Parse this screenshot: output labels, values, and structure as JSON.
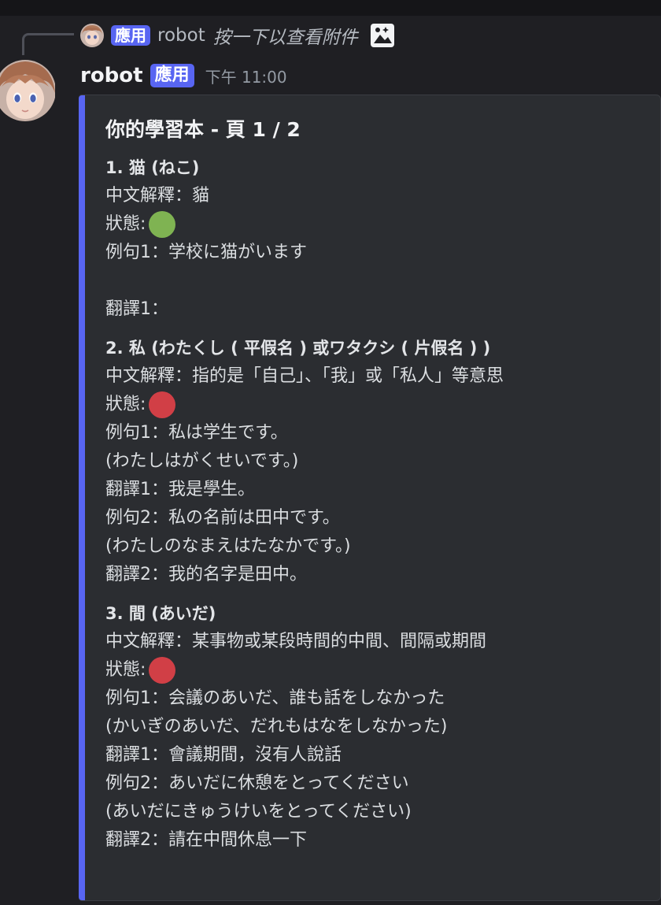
{
  "reply": {
    "badge": "應用",
    "author": "robot",
    "text": "按一下以查看附件",
    "attachment_icon": "image-icon"
  },
  "message": {
    "author": "robot",
    "badge": "應用",
    "timestamp": "下午 11:00"
  },
  "colors": {
    "accent": "#5865f2",
    "status_known": "#7fb352",
    "status_unknown": "#d13f46"
  },
  "embed": {
    "title": "你的學習本 - 頁 1 / 2",
    "entries": [
      {
        "heading": "1. 猫 (ねこ)",
        "meaning": "中文解釋：貓",
        "status_label": "狀態:",
        "status": "known",
        "ex1": "例句1：学校に猫がいます",
        "tr1": "翻譯1："
      },
      {
        "heading": "2. 私 (わたくし ( 平假名 ) 或ワタクシ ( 片假名 ) )",
        "meaning": "中文解釋：指的是「自己」、「我」或「私人」等意思",
        "status_label": "狀態:",
        "status": "unknown",
        "ex1": "例句1：私は学生です。",
        "ex1_reading": "(わたしはがくせいです。)",
        "tr1": "翻譯1：我是學生。",
        "ex2": "例句2：私の名前は田中です。",
        "ex2_reading": "(わたしのなまえはたなかです。)",
        "tr2": "翻譯2：我的名字是田中。"
      },
      {
        "heading": "3. 間 (あいだ)",
        "meaning": "中文解釋：某事物或某段時間的中間、間隔或期間",
        "status_label": "狀態:",
        "status": "unknown",
        "ex1": "例句1：会議のあいだ、誰も話をしなかった",
        "ex1_reading": "(かいぎのあいだ、だれもはなをしなかった)",
        "tr1": "翻譯1：會議期間，沒有人說話",
        "ex2": "例句2：あいだに休憩をとってください",
        "ex2_reading": "(あいだにきゅうけいをとってください)",
        "tr2": "翻譯2：請在中間休息一下"
      }
    ]
  }
}
